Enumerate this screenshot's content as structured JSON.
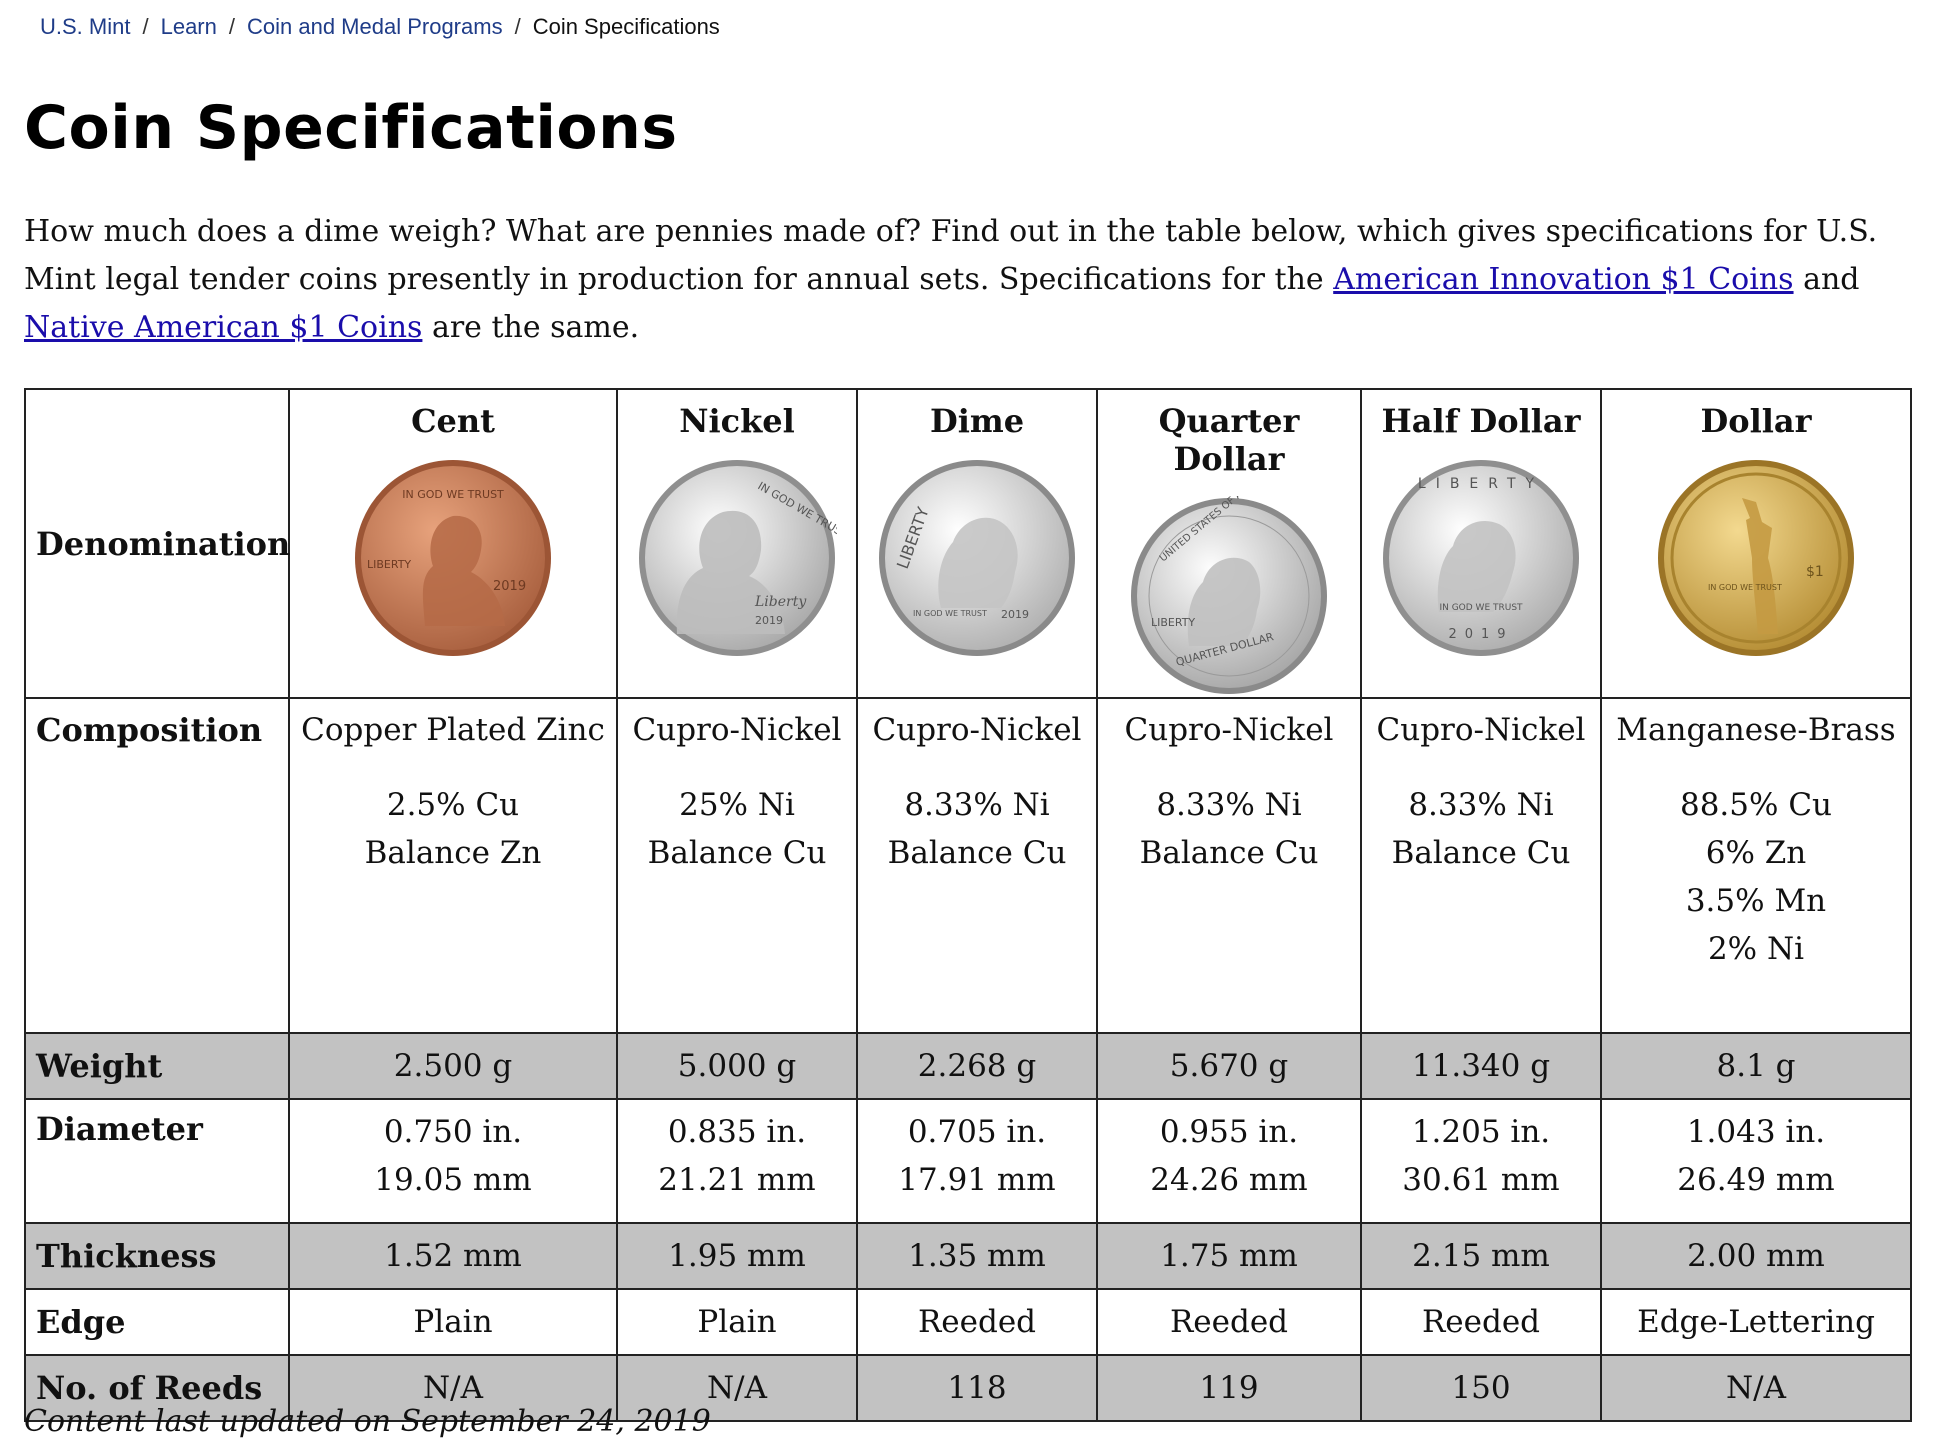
{
  "breadcrumb": {
    "items": [
      "U.S. Mint",
      "Learn",
      "Coin and Medal Programs"
    ],
    "current": "Coin Specifications",
    "separator": "/"
  },
  "page": {
    "title": "Coin Specifications",
    "intro_part1": "How much does a dime weigh? What are pennies made of? Find out in the table below, which gives specifications for U.S. Mint legal tender coins presently in production for annual sets. Specifications for the ",
    "link_innovation": "American Innovation $1 Coins",
    "intro_part2": " and ",
    "link_native": "Native American $1 Coins",
    "intro_part3": " are the same."
  },
  "table": {
    "row_labels": {
      "denomination": "Denomination",
      "composition": "Composition",
      "weight": "Weight",
      "diameter": "Diameter",
      "thickness": "Thickness",
      "edge": "Edge",
      "reeds": "No. of Reeds"
    },
    "coins": [
      {
        "name": "Cent",
        "composition": "Copper Plated Zinc",
        "comp_details": [
          "2.5% Cu",
          "Balance Zn"
        ],
        "weight": "2.500 g",
        "diameter_in": "0.750 in.",
        "diameter_mm": "19.05 mm",
        "thickness": "1.52 mm",
        "edge": "Plain",
        "reeds": "N/A",
        "coin_text": "IN GOD WE TRUST",
        "coin_liberty": "LIBERTY",
        "coin_year": "2019"
      },
      {
        "name": "Nickel",
        "composition": "Cupro-Nickel",
        "comp_details": [
          "25% Ni",
          "Balance Cu"
        ],
        "weight": "5.000 g",
        "diameter_in": "0.835 in.",
        "diameter_mm": "21.21 mm",
        "thickness": "1.95 mm",
        "edge": "Plain",
        "reeds": "N/A",
        "coin_text": "IN GOD WE TRUST",
        "coin_liberty": "Liberty",
        "coin_year": "2019"
      },
      {
        "name": "Dime",
        "composition": "Cupro-Nickel",
        "comp_details": [
          "8.33% Ni",
          "Balance Cu"
        ],
        "weight": "2.268 g",
        "diameter_in": "0.705 in.",
        "diameter_mm": "17.91 mm",
        "thickness": "1.35 mm",
        "edge": "Reeded",
        "reeds": "118",
        "coin_text": "LIBERTY",
        "coin_liberty": "IN GOD WE TRUST",
        "coin_year": "2019"
      },
      {
        "name": "Quarter Dollar",
        "composition": "Cupro-Nickel",
        "comp_details": [
          "8.33% Ni",
          "Balance Cu"
        ],
        "weight": "5.670 g",
        "diameter_in": "0.955 in.",
        "diameter_mm": "24.26 mm",
        "thickness": "1.75 mm",
        "edge": "Reeded",
        "reeds": "119",
        "coin_text": "UNITED STATES OF AMERICA",
        "coin_liberty": "LIBERTY",
        "coin_year": "QUARTER DOLLAR"
      },
      {
        "name": "Half Dollar",
        "composition": "Cupro-Nickel",
        "comp_details": [
          "8.33% Ni",
          "Balance Cu"
        ],
        "weight": "11.340 g",
        "diameter_in": "1.205 in.",
        "diameter_mm": "30.61 mm",
        "thickness": "2.15 mm",
        "edge": "Reeded",
        "reeds": "150",
        "coin_text": "LIBERTY",
        "coin_liberty": "IN GOD WE TRUST",
        "coin_year": "2019"
      },
      {
        "name": "Dollar",
        "composition": "Manganese-Brass",
        "comp_details": [
          "88.5% Cu",
          "6% Zn",
          "3.5% Mn",
          "2% Ni"
        ],
        "weight": "8.1 g",
        "diameter_in": "1.043 in.",
        "diameter_mm": "26.49 mm",
        "thickness": "2.00 mm",
        "edge": "Edge-Lettering",
        "reeds": "N/A",
        "coin_text": "IN GOD WE TRUST",
        "coin_liberty": "$1",
        "coin_year": ""
      }
    ]
  },
  "footer": {
    "updated": "Content last updated on September 24, 2019"
  },
  "colors": {
    "link": "#1a0dab",
    "breadcrumb_link": "#1f3c88",
    "shaded_row": "#c2c2c2",
    "copper": "#c9805a",
    "silver": "#d9d9d9",
    "brass": "#d8b45a"
  }
}
